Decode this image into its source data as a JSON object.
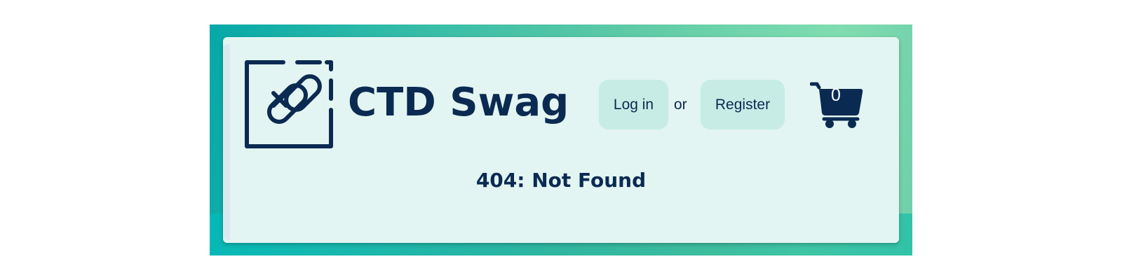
{
  "header": {
    "site_title": "CTD Swag",
    "login_label": "Log in",
    "or_label": "or",
    "register_label": "Register",
    "cart_count": "0"
  },
  "main": {
    "message": "404: Not Found"
  },
  "icons": {
    "logo": "broken-link-icon",
    "cart": "shopping-cart-icon"
  },
  "colors": {
    "brand_navy": "#0b2a52",
    "card_bg": "#e2f5f2",
    "button_bg": "#c6ece5",
    "frame_gradient_start": "#05a8a8",
    "frame_gradient_end": "#80ddb0"
  }
}
